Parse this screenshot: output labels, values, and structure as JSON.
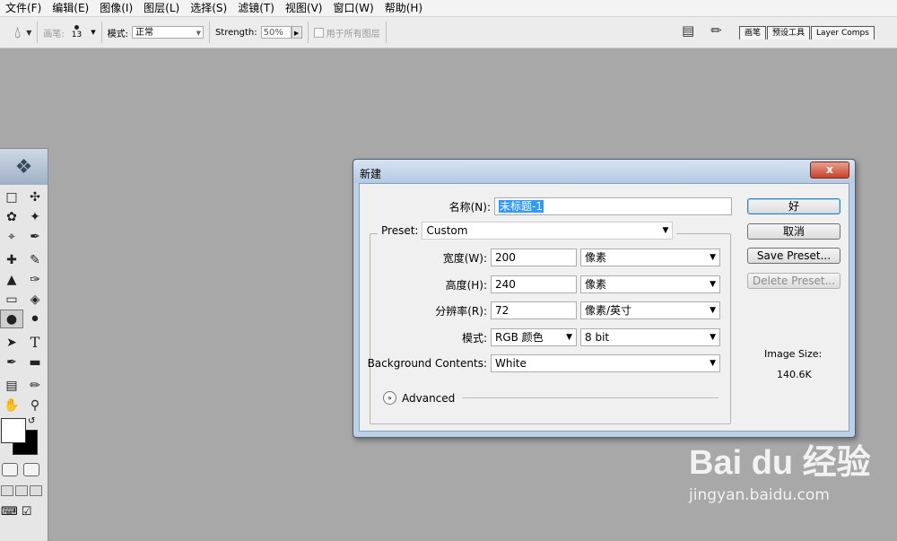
{
  "menu": [
    "文件(F)",
    "编辑(E)",
    "图像(I)",
    "图层(L)",
    "选择(S)",
    "滤镜(T)",
    "视图(V)",
    "窗口(W)",
    "帮助(H)"
  ],
  "options": {
    "brush_label": "画笔:",
    "brush_size": "13",
    "mode_label": "模式:",
    "mode_value": "正常",
    "strength_label": "Strength:",
    "strength_value": "50%",
    "sample_all_label": "用于所有图层"
  },
  "palette_tabs": [
    "画笔",
    "预设工具",
    "Layer Comps"
  ],
  "dialog": {
    "title": "新建",
    "close_glyph": "x",
    "name_label": "名称(N):",
    "name_value": "未标题-1",
    "preset_label": "Preset:",
    "preset_value": "Custom",
    "width_label": "宽度(W):",
    "width_value": "200",
    "width_unit": "像素",
    "height_label": "高度(H):",
    "height_value": "240",
    "height_unit": "像素",
    "resolution_label": "分辨率(R):",
    "resolution_value": "72",
    "resolution_unit": "像素/英寸",
    "mode_label": "模式:",
    "mode_value": "RGB 颜色",
    "depth_value": "8 bit",
    "background_label": "Background Contents:",
    "background_value": "White",
    "advanced_label": "Advanced",
    "ok_label": "好",
    "cancel_label": "取消",
    "save_preset_label": "Save Preset...",
    "delete_preset_label": "Delete Preset...",
    "image_size_label": "Image Size:",
    "image_size_value": "140.6K"
  },
  "watermark": {
    "logo": "Bai du 经验",
    "url": "jingyan.baidu.com"
  },
  "colors": {
    "workspace": "#a8a8a8",
    "dialog_frame": "#bcd0e6",
    "selection": "#3399ff",
    "close_button": "#c7432a"
  },
  "icons": {
    "tool_preset": "water-drop-icon",
    "palette_well": "document-icon",
    "toolbox_header": "feather-icon"
  }
}
